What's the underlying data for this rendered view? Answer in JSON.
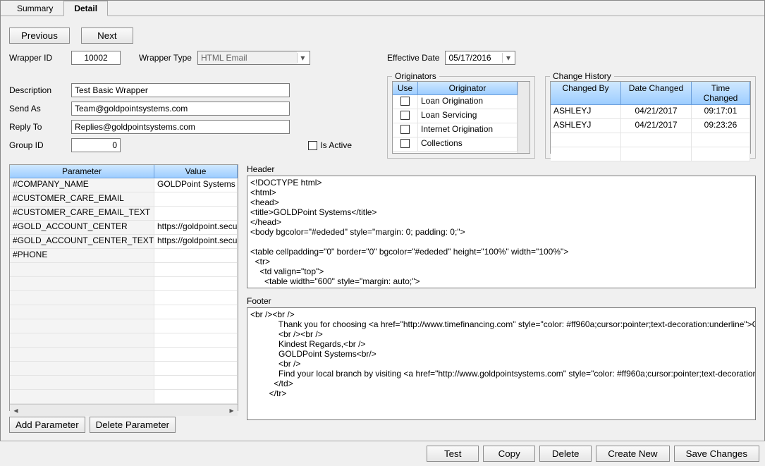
{
  "tabs": {
    "summary": "Summary",
    "detail": "Detail"
  },
  "nav": {
    "previous": "Previous",
    "next": "Next"
  },
  "fields": {
    "wrapper_id_label": "Wrapper ID",
    "wrapper_id_value": "10002",
    "wrapper_type_label": "Wrapper Type",
    "wrapper_type_value": "HTML Email",
    "effective_date_label": "Effective Date",
    "effective_date_value": "05/17/2016",
    "description_label": "Description",
    "description_value": "Test Basic Wrapper",
    "send_as_label": "Send As",
    "send_as_value": "Team@goldpointsystems.com",
    "reply_to_label": "Reply To",
    "reply_to_value": "Replies@goldpointsystems.com",
    "group_id_label": "Group ID",
    "group_id_value": "0",
    "is_active_label": "Is Active"
  },
  "originators": {
    "legend": "Originators",
    "headers": {
      "use": "Use",
      "originator": "Originator"
    },
    "rows": [
      "Loan Origination",
      "Loan Servicing",
      "Internet Origination",
      "Collections"
    ]
  },
  "change_history": {
    "legend": "Change History",
    "headers": {
      "changed_by": "Changed By",
      "date_changed": "Date Changed",
      "time_changed": "Time Changed"
    },
    "rows": [
      {
        "by": "ASHLEYJ",
        "date": "04/21/2017",
        "time": "09:17:01"
      },
      {
        "by": "ASHLEYJ",
        "date": "04/21/2017",
        "time": "09:23:26"
      }
    ]
  },
  "parameters": {
    "headers": {
      "parameter": "Parameter",
      "value": "Value"
    },
    "rows": [
      {
        "p": "#COMPANY_NAME",
        "v": "GOLDPoint Systems"
      },
      {
        "p": "#CUSTOMER_CARE_EMAIL",
        "v": ""
      },
      {
        "p": "#CUSTOMER_CARE_EMAIL_TEXT",
        "v": ""
      },
      {
        "p": "#GOLD_ACCOUNT_CENTER",
        "v": "https://goldpoint.secure"
      },
      {
        "p": "#GOLD_ACCOUNT_CENTER_TEXT",
        "v": "https://goldpoint.secure"
      },
      {
        "p": "#PHONE",
        "v": ""
      }
    ]
  },
  "param_buttons": {
    "add": "Add Parameter",
    "delete": "Delete Parameter"
  },
  "header_section": {
    "label": "Header",
    "text": "<!DOCTYPE html>\n<html>\n<head>\n<title>GOLDPoint Systems</title>\n</head>\n<body bgcolor=\"#ededed\" style=\"margin: 0; padding: 0;\">\n\n<table cellpadding=\"0\" border=\"0\" bgcolor=\"#ededed\" height=\"100%\" width=\"100%\">\n  <tr>\n    <td valign=\"top\">\n      <table width=\"600\" style=\"margin: auto;\">"
  },
  "footer_section": {
    "label": "Footer",
    "text": "<br /><br />\n            Thank you for choosing <a href=\"http://www.timefinancing.com\" style=\"color: #ff960a;cursor:pointer;text-decoration:underline\">GOLDPoint Systems</a>\n            <br /><br />\n            Kindest Regards,<br />\n            GOLDPoint Systems<br/>\n            <br />\n            Find your local branch by visiting <a href=\"http://www.goldpointsystems.com\" style=\"color: #ff960a;cursor:pointer;text-decoration:underline\">www.goldpointsystems.com</a>\n          </td>\n        </tr>"
  },
  "bottom_buttons": {
    "test": "Test",
    "copy": "Copy",
    "delete": "Delete",
    "create_new": "Create New",
    "save": "Save Changes"
  }
}
